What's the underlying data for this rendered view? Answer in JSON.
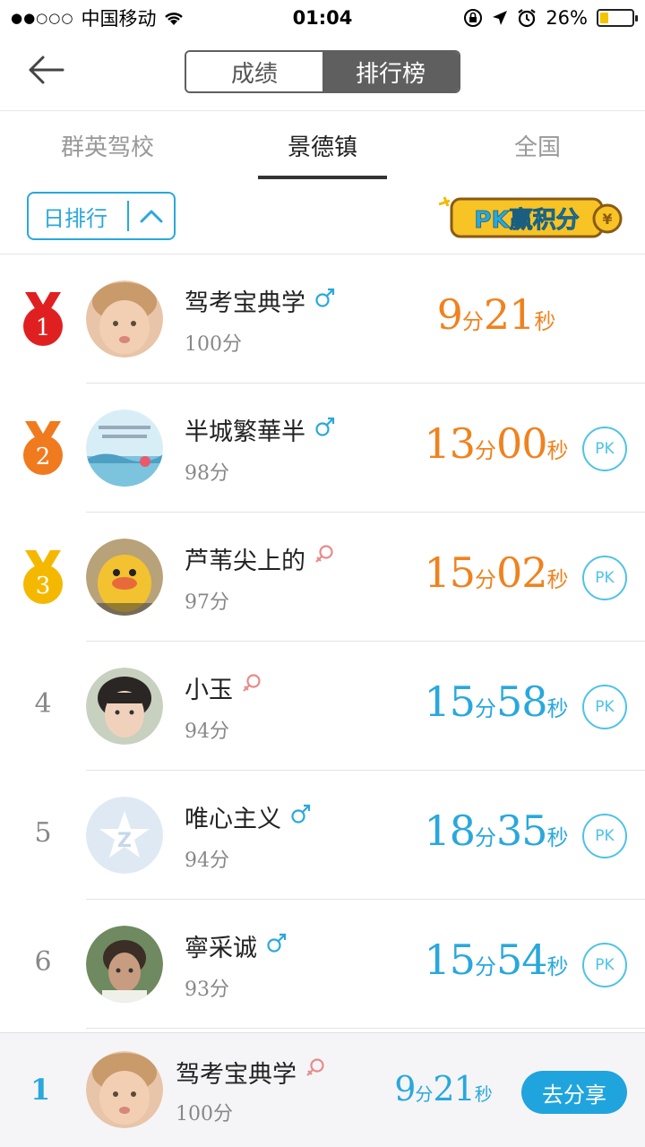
{
  "status": {
    "carrier": "中国移动",
    "time": "01:04",
    "battery": "26%",
    "battery_level": 0.26
  },
  "nav": {
    "seg_left": "成绩",
    "seg_right": "排行榜"
  },
  "tabs": [
    "群英驾校",
    "景德镇",
    "全国"
  ],
  "filter": {
    "dropdown_label": "日排行",
    "pk_badge": "PK赢积分"
  },
  "rows": [
    {
      "rank": "1",
      "name": "驾考宝典学",
      "gender": "male",
      "score": "100分",
      "min": "9",
      "sec": "21",
      "pk": ""
    },
    {
      "rank": "2",
      "name": "半城繁華半",
      "gender": "male",
      "score": "98分",
      "min": "13",
      "sec": "00",
      "pk": "PK"
    },
    {
      "rank": "3",
      "name": "芦苇尖上的",
      "gender": "female",
      "score": "97分",
      "min": "15",
      "sec": "02",
      "pk": "PK"
    },
    {
      "rank": "4",
      "name": "小玉",
      "gender": "female",
      "score": "94分",
      "min": "15",
      "sec": "58",
      "pk": "PK"
    },
    {
      "rank": "5",
      "name": "唯心主义",
      "gender": "male",
      "score": "94分",
      "min": "18",
      "sec": "35",
      "pk": "PK"
    },
    {
      "rank": "6",
      "name": "寧采诚",
      "gender": "male",
      "score": "93分",
      "min": "15",
      "sec": "54",
      "pk": "PK"
    }
  ],
  "units": {
    "min": "分",
    "sec": "秒"
  },
  "footer": {
    "rank": "1",
    "name": "驾考宝典学",
    "gender": "female",
    "score": "100分",
    "min": "9",
    "sec": "21",
    "share": "去分享"
  },
  "colors": {
    "accent": "#29a8dc",
    "orange": "#f0821e",
    "gold": "#f5b800",
    "red": "#e02020",
    "male": "#29a8dc",
    "female": "#e88a8a"
  }
}
